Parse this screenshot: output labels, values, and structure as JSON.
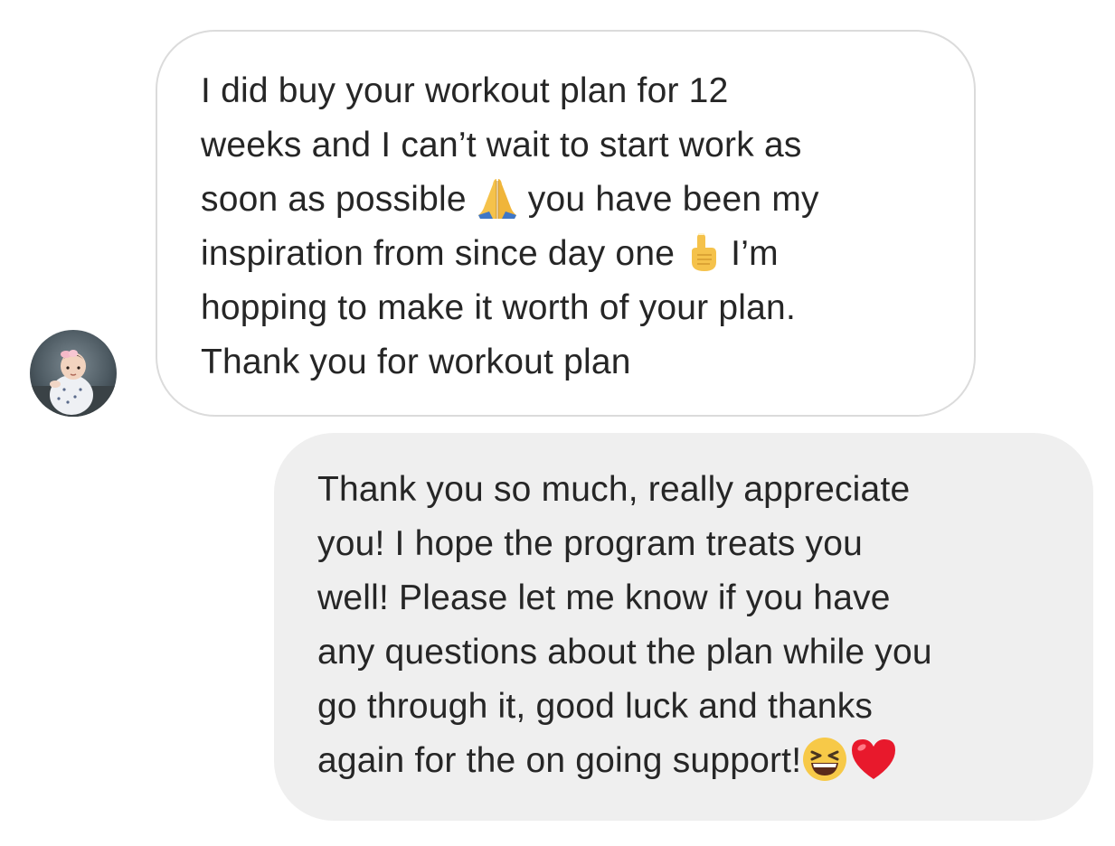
{
  "conversation": {
    "incoming": {
      "avatar_icon": "baby-avatar-photo",
      "lines": [
        {
          "text": "I did buy your workout plan for 12"
        },
        {
          "text": "weeks and I can’t wait to start work as"
        },
        {
          "before": "soon as possible ",
          "emoji": "🙏",
          "emoji_icon": "folded-hands-icon",
          "after": " you have been my"
        },
        {
          "before": "inspiration from since day one ",
          "emoji": "☝️",
          "emoji_icon": "index-pointing-up-icon",
          "after": " I’m"
        },
        {
          "text": "hopping to make it worth of your plan."
        },
        {
          "text": "Thank you for workout plan"
        }
      ]
    },
    "outgoing": {
      "lines": [
        {
          "text": "Thank you so much, really appreciate"
        },
        {
          "text": "you! I hope the program treats you"
        },
        {
          "text": "well! Please let me know if you have"
        },
        {
          "text": "any questions about the plan while you"
        },
        {
          "text": "go through it, good luck and thanks"
        },
        {
          "before": "again for the on going support!",
          "emojis": [
            "😆",
            "❤️"
          ],
          "emoji_icons": [
            "grinning-squinting-face-icon",
            "red-heart-icon"
          ]
        }
      ]
    }
  }
}
